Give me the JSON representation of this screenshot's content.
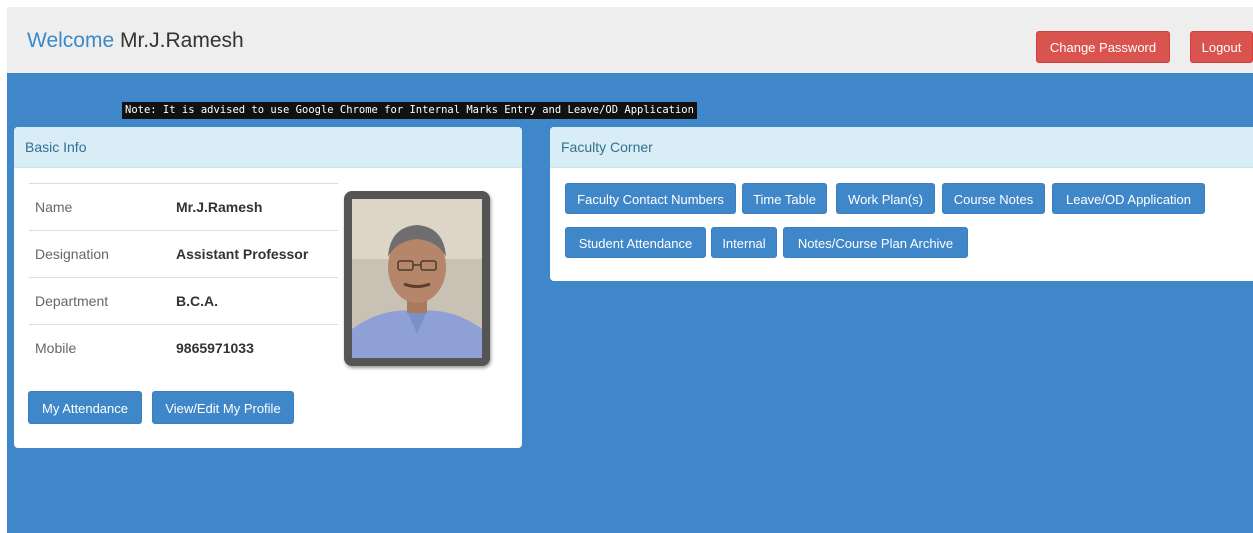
{
  "header": {
    "welcome_prefix": "Welcome",
    "welcome_name": "Mr.J.Ramesh",
    "change_password_label": "Change Password",
    "logout_label": "Logout"
  },
  "note": "Note: It is advised to use Google Chrome for Internal Marks Entry and Leave/OD Application",
  "basic_info": {
    "title": "Basic Info",
    "rows": [
      {
        "label": "Name",
        "value": "Mr.J.Ramesh"
      },
      {
        "label": "Designation",
        "value": "Assistant Professor"
      },
      {
        "label": "Department",
        "value": "B.C.A."
      },
      {
        "label": "Mobile",
        "value": "9865971033"
      }
    ],
    "my_attendance_label": "My Attendance",
    "edit_profile_label": "View/Edit My Profile"
  },
  "faculty_corner": {
    "title": "Faculty Corner",
    "buttons": [
      "Faculty Contact Numbers",
      "Time Table",
      "Work Plan(s)",
      "Course Notes",
      "Leave/OD Application",
      "Student Attendance",
      "Internal",
      "Notes/Course Plan Archive"
    ]
  },
  "colors": {
    "accent_blue": "#3f87c9",
    "danger_red": "#d9534f",
    "panel_heading": "#d9edf7"
  }
}
